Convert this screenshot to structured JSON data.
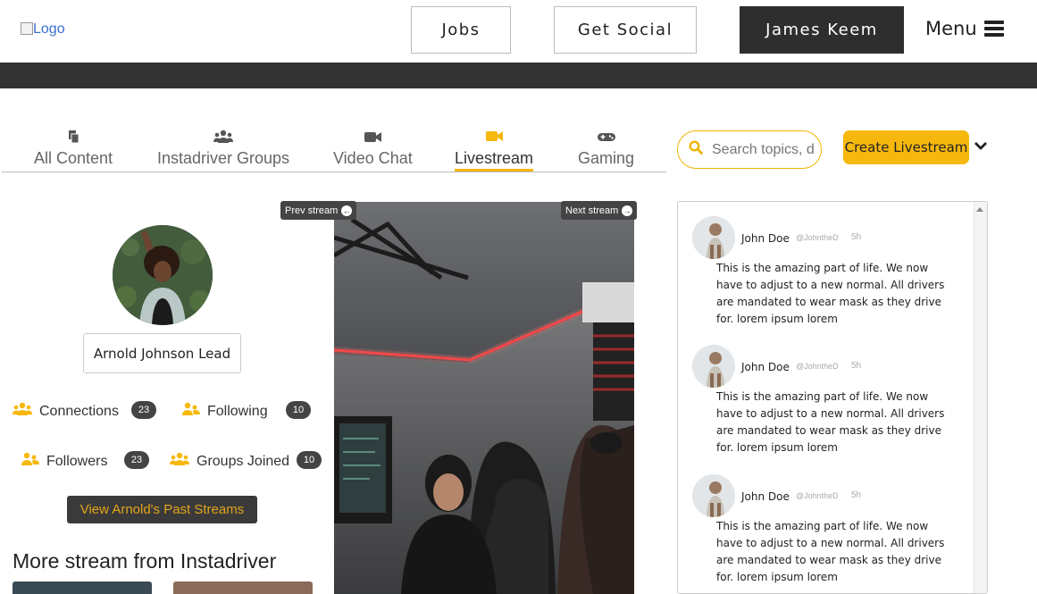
{
  "header": {
    "logo_alt": "Logo",
    "nav": [
      {
        "label": "Jobs"
      },
      {
        "label": "Get Social"
      },
      {
        "label": "James Keem"
      }
    ],
    "menu_label": "Menu"
  },
  "tabs": [
    {
      "label": "All Content",
      "icon": "files-icon"
    },
    {
      "label": "Instadriver Groups",
      "icon": "users-icon"
    },
    {
      "label": "Video Chat",
      "icon": "video-icon"
    },
    {
      "label": "Livestream",
      "icon": "video-icon",
      "active": true
    },
    {
      "label": "Gaming",
      "icon": "gamepad-icon"
    }
  ],
  "search": {
    "placeholder": "Search topics, d"
  },
  "create_button": "Create Livestream",
  "profile": {
    "name": "Arnold Johnson Lead",
    "stats": [
      {
        "label": "Connections",
        "count": "23"
      },
      {
        "label": "Following",
        "count": "10"
      },
      {
        "label": "Followers",
        "count": "23"
      },
      {
        "label": "Groups Joined",
        "count": "10"
      }
    ],
    "past_streams_button": "View Arnold's Past Streams",
    "more_heading": "More stream from Instadriver"
  },
  "stream": {
    "prev_label": "Prev stream",
    "next_label": "Next stream"
  },
  "feed": [
    {
      "name": "John Doe",
      "handle": "@JohntheD",
      "time": "5h",
      "text": "This is the amazing part of life. We now have to adjust to a new normal. All drivers are mandated to wear mask as they drive for. lorem ipsum lorem"
    },
    {
      "name": "John Doe",
      "handle": "@JohntheD",
      "time": "5h",
      "text": "This is the amazing part of life. We now have to adjust to a new normal. All drivers are mandated to wear mask as they drive for. lorem ipsum lorem"
    },
    {
      "name": "John Doe",
      "handle": "@JohntheD",
      "time": "5h",
      "text": "This is the amazing part of life. We now have to adjust to a new normal. All drivers are mandated to wear mask as they drive for. lorem ipsum lorem"
    }
  ],
  "colors": {
    "accent": "#f6b80c",
    "dark": "#333333",
    "badge": "#444444"
  }
}
